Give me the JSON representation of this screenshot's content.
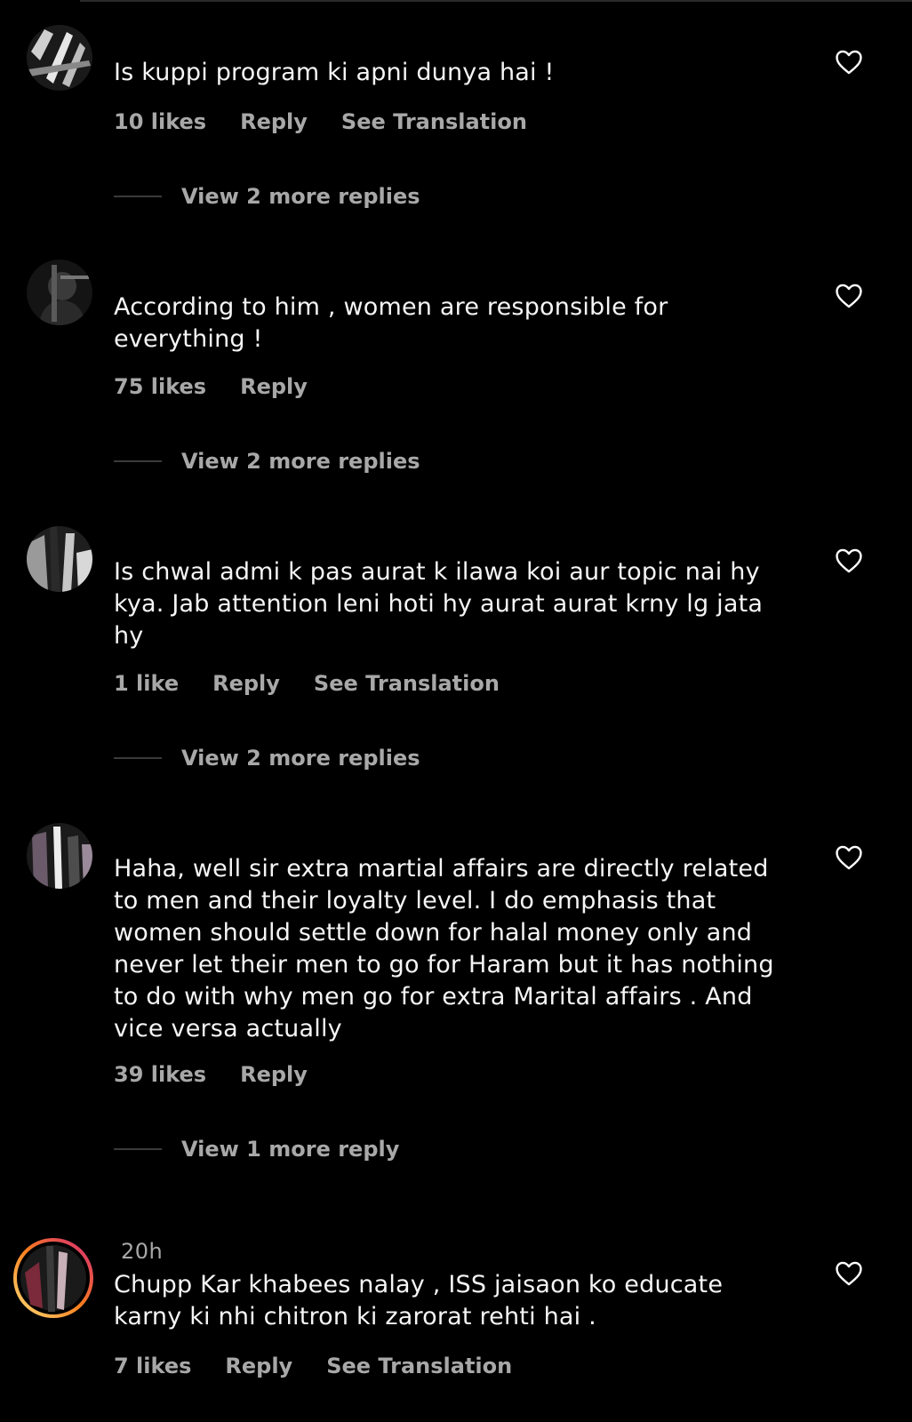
{
  "comments": [
    {
      "username": "",
      "time": "",
      "text": "Is kuppi program ki apni dunya hai !",
      "likes": "10 likes",
      "reply": "Reply",
      "translation": "See Translation",
      "view_replies": "View 2 more replies",
      "avatar_color": "#6e6e6e"
    },
    {
      "username": "",
      "time": "",
      "text": "According to him , women are responsible for everything !",
      "likes": "75 likes",
      "reply": "Reply",
      "translation": "",
      "view_replies": "View 2 more replies",
      "avatar_color": "#4d4d4d"
    },
    {
      "username": "",
      "time": "",
      "text": "Is chwal admi k pas aurat k ilawa koi aur topic nai hy kya. Jab attention leni hoti hy aurat aurat krny lg jata hy",
      "likes": "1 like",
      "reply": "Reply",
      "translation": "See Translation",
      "view_replies": "View 2 more replies",
      "avatar_color": "#8a8a8a"
    },
    {
      "username": "",
      "time": "",
      "text": "Haha, well sir extra martial affairs are directly related to men and their loyalty level. I do emphasis that women should settle down for halal money only and never let their men to go for Haram but it has nothing to do with why men go for extra Marital affairs . And vice versa actually",
      "likes": "39 likes",
      "reply": "Reply",
      "translation": "",
      "view_replies": "View 1 more reply",
      "avatar_color": "#5a4a5a"
    },
    {
      "username": "",
      "time": "20h",
      "text": "Chupp Kar khabees nalay , ISS jaisaon ko educate karny ki nhi chitron ki zarorat rehti hai .",
      "likes": "7 likes",
      "reply": "Reply",
      "translation": "See Translation",
      "view_replies": "",
      "avatar_color": "#7a2a3a"
    }
  ],
  "colors": {
    "background": "#000000",
    "text_primary": "#f5f5f5",
    "text_secondary": "#a8a8a8",
    "story_ring_start": "#d62976",
    "story_ring_end": "#feda75"
  },
  "icons": {
    "like": "heart-outline-icon"
  }
}
